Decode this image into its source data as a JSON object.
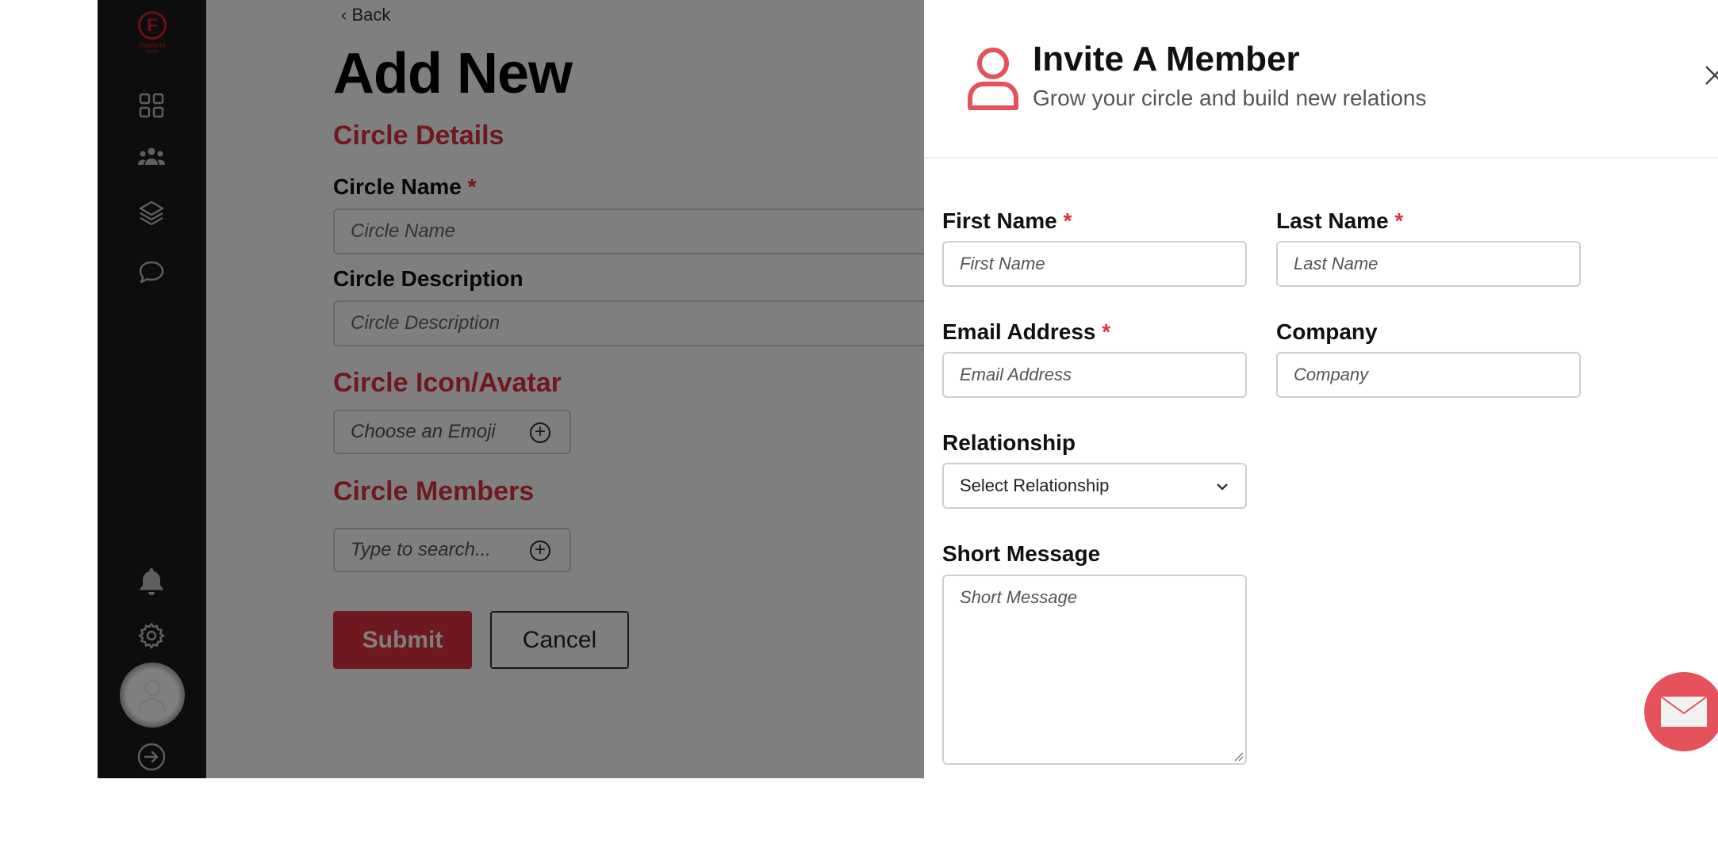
{
  "brand": {
    "logo_letter": "F",
    "name": "Platform",
    "sub": "circle",
    "accent": "#e0313f"
  },
  "sidebar": {
    "items": [
      {
        "icon": "grid-icon"
      },
      {
        "icon": "people-icon"
      },
      {
        "icon": "layers-icon"
      },
      {
        "icon": "chat-icon"
      },
      {
        "icon": "bell-icon"
      },
      {
        "icon": "gear-icon"
      },
      {
        "icon": "avatar"
      },
      {
        "icon": "logout-icon"
      }
    ]
  },
  "main": {
    "back_label": "Back",
    "title": "Add New",
    "sections": {
      "details": "Circle Details",
      "icon": "Circle Icon/Avatar",
      "members": "Circle Members"
    },
    "fields": {
      "circle_name_label": "Circle Name",
      "circle_name_placeholder": "Circle Name",
      "circle_desc_label": "Circle Description",
      "circle_desc_placeholder": "Circle Description",
      "emoji_placeholder": "Choose an Emoji",
      "member_search_placeholder": "Type to search..."
    },
    "buttons": {
      "submit": "Submit",
      "cancel": "Cancel"
    },
    "required_mark": "*"
  },
  "drawer": {
    "title": "Invite A Member",
    "subtitle": "Grow your circle and build new relations",
    "fields": {
      "first_name_label": "First Name",
      "first_name_placeholder": "First Name",
      "last_name_label": "Last Name",
      "last_name_placeholder": "Last Name",
      "email_label": "Email Address",
      "email_placeholder": "Email Address",
      "company_label": "Company",
      "company_placeholder": "Company",
      "relationship_label": "Relationship",
      "relationship_value": "Select Relationship",
      "message_label": "Short Message",
      "message_placeholder": "Short Message"
    },
    "required_mark": "*"
  },
  "fab": {
    "icon": "mail-icon",
    "color": "#e5525c"
  }
}
